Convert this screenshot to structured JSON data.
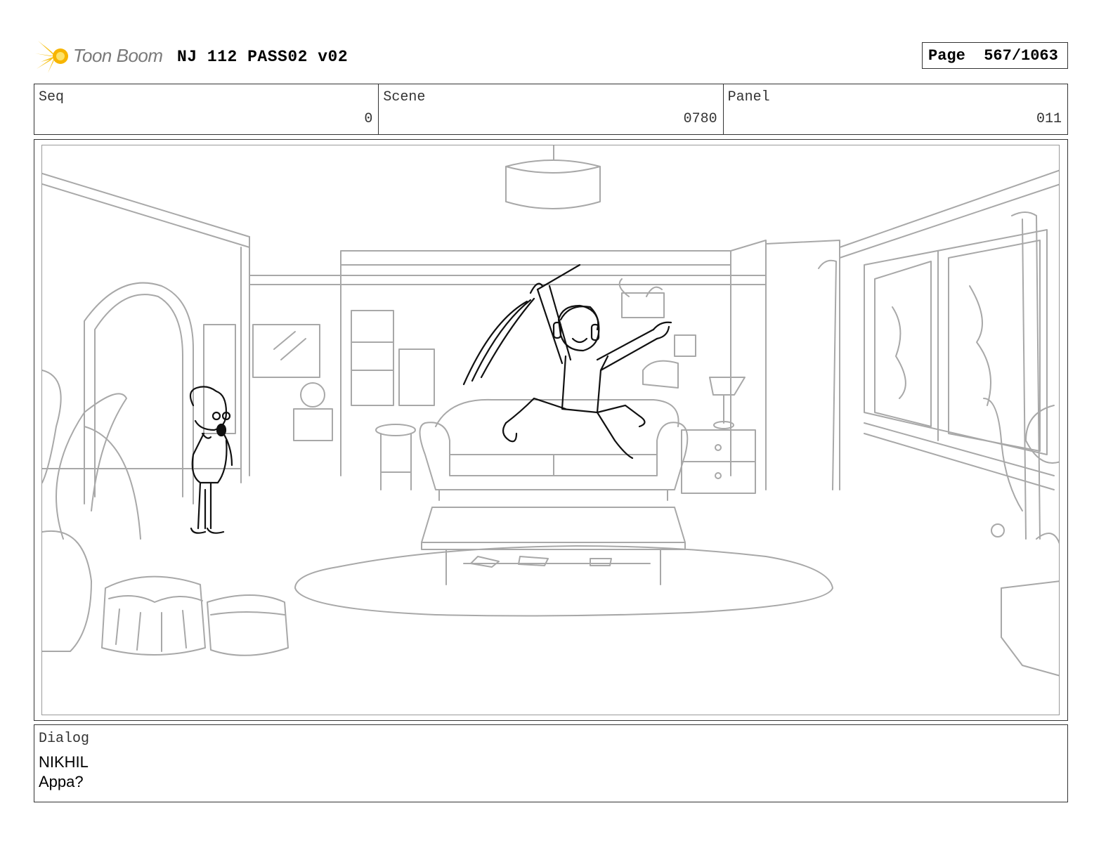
{
  "header": {
    "logo_text": "Toon Boom",
    "document_title": "NJ 112 PASS02 v02",
    "page_indicator": "Page  567/1063"
  },
  "info": {
    "seq_label": "Seq",
    "seq_value": "0",
    "scene_label": "Scene",
    "scene_value": "0780",
    "panel_label": "Panel",
    "panel_value": "011"
  },
  "panel": {
    "image": "storyboard-sketch"
  },
  "dialog": {
    "label": "Dialog",
    "speaker": "NIKHIL",
    "line": "Appa?"
  }
}
